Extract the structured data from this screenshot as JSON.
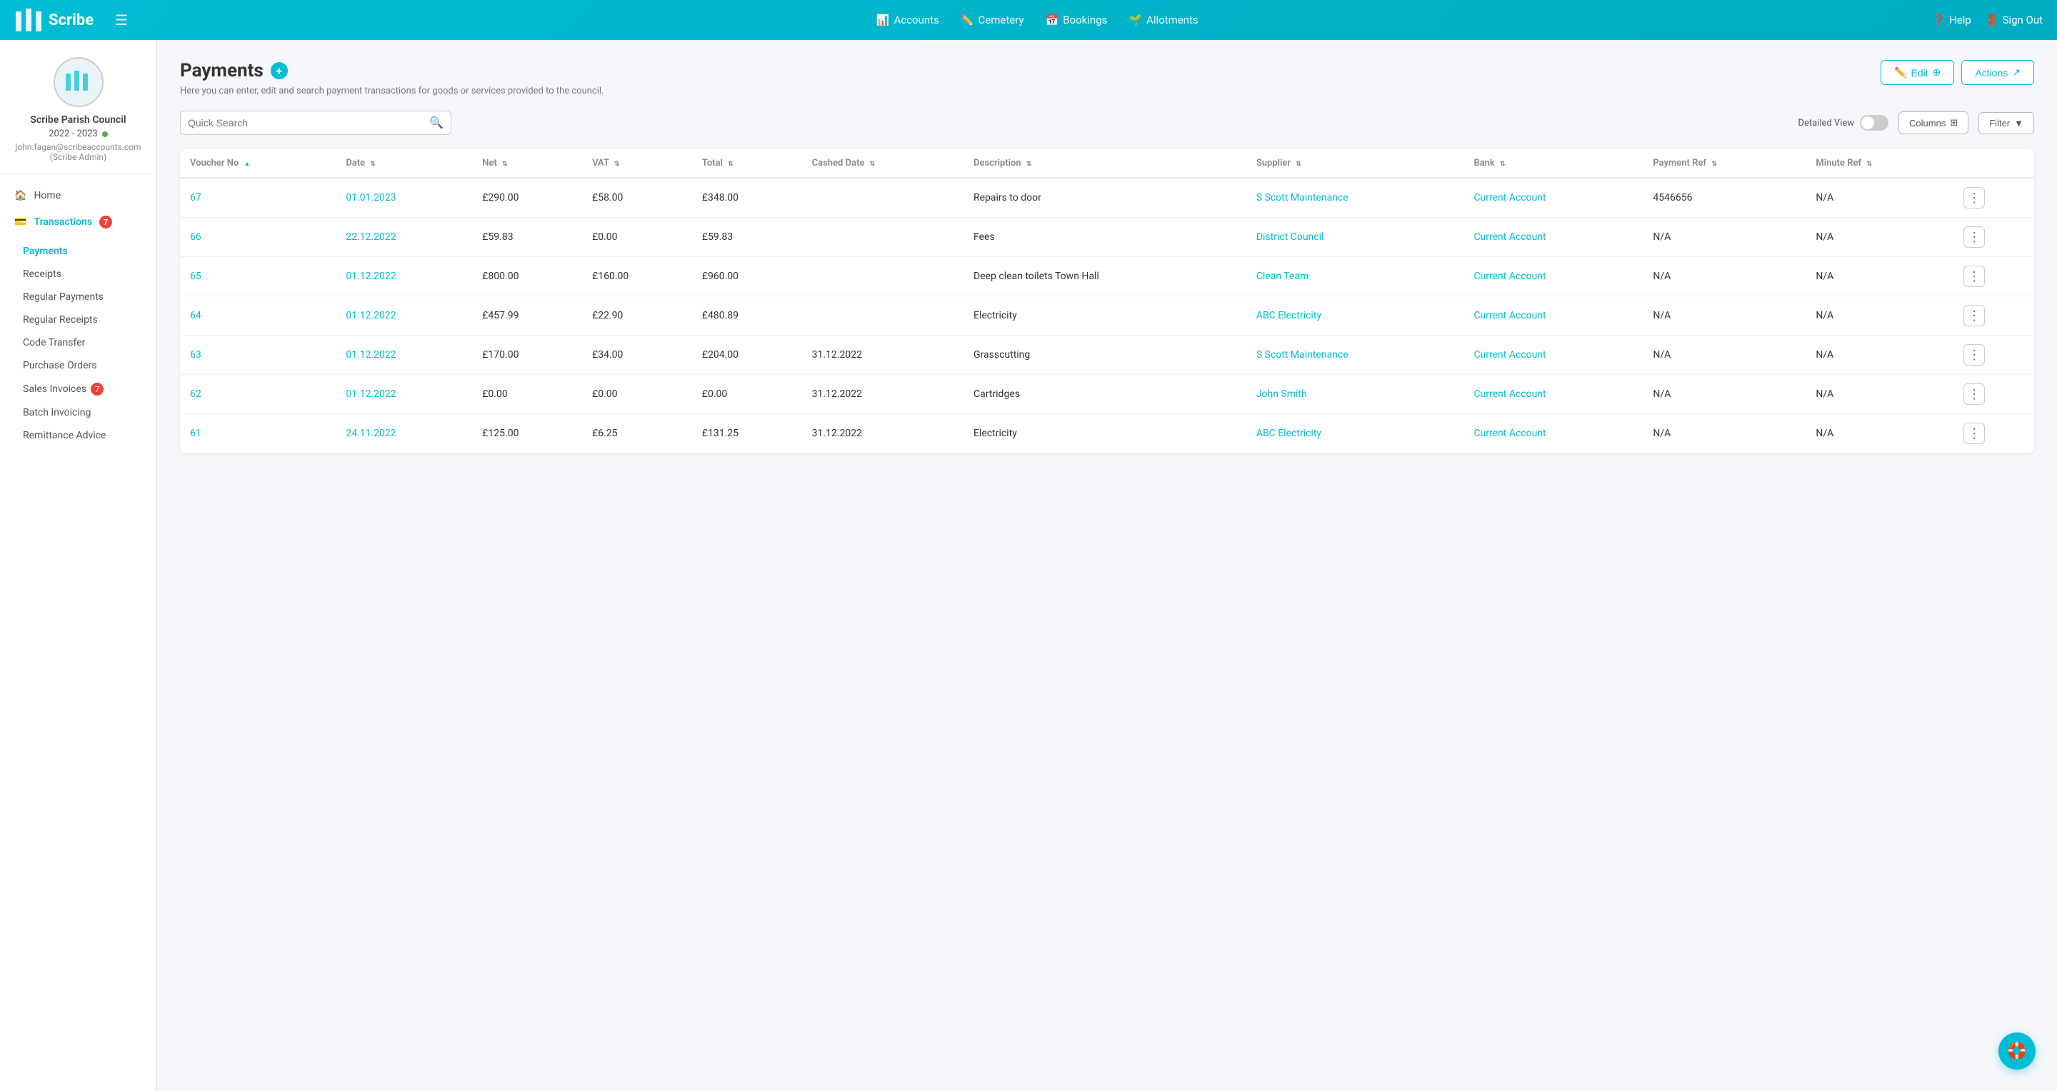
{
  "app": {
    "name": "Scribe",
    "logo_alt": "Scribe Logo"
  },
  "topnav": {
    "hamburger_label": "☰",
    "links": [
      {
        "id": "accounts",
        "label": "Accounts",
        "icon": "📊"
      },
      {
        "id": "cemetery",
        "label": "Cemetery",
        "icon": "✏️"
      },
      {
        "id": "bookings",
        "label": "Bookings",
        "icon": "📅"
      },
      {
        "id": "allotments",
        "label": "Allotments",
        "icon": "🌱"
      }
    ],
    "help_label": "Help",
    "signout_label": "Sign Out"
  },
  "sidebar": {
    "council_name": "Scribe Parish Council",
    "year": "2022 - 2023",
    "email": "john.fagan@scribeaccounts.com",
    "role": "(Scribe Admin)",
    "home_label": "Home",
    "transactions_label": "Transactions",
    "transactions_badge": "7",
    "nav_items": [
      {
        "id": "payments",
        "label": "Payments",
        "active": true
      },
      {
        "id": "receipts",
        "label": "Receipts"
      },
      {
        "id": "regular-payments",
        "label": "Regular Payments"
      },
      {
        "id": "regular-receipts",
        "label": "Regular Receipts"
      },
      {
        "id": "code-transfer",
        "label": "Code Transfer"
      },
      {
        "id": "purchase-orders",
        "label": "Purchase Orders"
      },
      {
        "id": "sales-invoices",
        "label": "Sales Invoices",
        "badge": "7"
      },
      {
        "id": "batch-invoicing",
        "label": "Batch Invoicing"
      },
      {
        "id": "remittance-advice",
        "label": "Remittance Advice"
      }
    ]
  },
  "page": {
    "title": "Payments",
    "subtitle": "Here you can enter, edit and search payment transactions for goods or services provided to the council.",
    "edit_label": "Edit",
    "actions_label": "Actions"
  },
  "search": {
    "placeholder": "Quick Search"
  },
  "controls": {
    "detailed_view_label": "Detailed View",
    "columns_label": "Columns",
    "filter_label": "Filter"
  },
  "table": {
    "columns": [
      {
        "id": "voucher_no",
        "label": "Voucher No",
        "sortable": true
      },
      {
        "id": "date",
        "label": "Date",
        "sortable": true
      },
      {
        "id": "net",
        "label": "Net",
        "sortable": true
      },
      {
        "id": "vat",
        "label": "VAT",
        "sortable": true
      },
      {
        "id": "total",
        "label": "Total",
        "sortable": true
      },
      {
        "id": "cashed_date",
        "label": "Cashed Date",
        "sortable": true
      },
      {
        "id": "description",
        "label": "Description",
        "sortable": true
      },
      {
        "id": "supplier",
        "label": "Supplier",
        "sortable": true
      },
      {
        "id": "bank",
        "label": "Bank",
        "sortable": true
      },
      {
        "id": "payment_ref",
        "label": "Payment Ref",
        "sortable": true
      },
      {
        "id": "minute_ref",
        "label": "Minute Ref",
        "sortable": true
      },
      {
        "id": "actions",
        "label": ""
      }
    ],
    "rows": [
      {
        "voucher_no": "67",
        "date": "01.01.2023",
        "net": "£290.00",
        "vat": "£58.00",
        "total": "£348.00",
        "cashed_date": "",
        "description": "Repairs to door",
        "supplier": "S Scott Maintenance",
        "bank": "Current Account",
        "payment_ref": "4546656",
        "minute_ref": "N/A"
      },
      {
        "voucher_no": "66",
        "date": "22.12.2022",
        "net": "£59.83",
        "vat": "£0.00",
        "total": "£59.83",
        "cashed_date": "",
        "description": "Fees",
        "supplier": "District Council",
        "bank": "Current Account",
        "payment_ref": "N/A",
        "minute_ref": "N/A"
      },
      {
        "voucher_no": "65",
        "date": "01.12.2022",
        "net": "£800.00",
        "vat": "£160.00",
        "total": "£960.00",
        "cashed_date": "",
        "description": "Deep clean toilets Town Hall",
        "supplier": "Clean Team",
        "bank": "Current Account",
        "payment_ref": "N/A",
        "minute_ref": "N/A"
      },
      {
        "voucher_no": "64",
        "date": "01.12.2022",
        "net": "£457.99",
        "vat": "£22.90",
        "total": "£480.89",
        "cashed_date": "",
        "description": "Electricity",
        "supplier": "ABC Electricity",
        "bank": "Current Account",
        "payment_ref": "N/A",
        "minute_ref": "N/A"
      },
      {
        "voucher_no": "63",
        "date": "01.12.2022",
        "net": "£170.00",
        "vat": "£34.00",
        "total": "£204.00",
        "cashed_date": "31.12.2022",
        "description": "Grasscutting",
        "supplier": "S Scott Maintenance",
        "bank": "Current Account",
        "payment_ref": "N/A",
        "minute_ref": "N/A"
      },
      {
        "voucher_no": "62",
        "date": "01.12.2022",
        "net": "£0.00",
        "vat": "£0.00",
        "total": "£0.00",
        "cashed_date": "31.12.2022",
        "description": "Cartridges",
        "supplier": "John Smith",
        "bank": "Current Account",
        "payment_ref": "N/A",
        "minute_ref": "N/A"
      },
      {
        "voucher_no": "61",
        "date": "24.11.2022",
        "net": "£125.00",
        "vat": "£6.25",
        "total": "£131.25",
        "cashed_date": "31.12.2022",
        "description": "Electricity",
        "supplier": "ABC Electricity",
        "bank": "Current Account",
        "payment_ref": "N/A",
        "minute_ref": "N/A"
      }
    ]
  }
}
